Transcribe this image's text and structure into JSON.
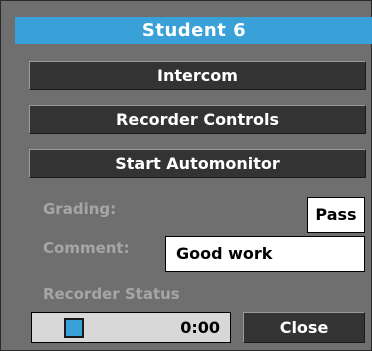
{
  "window": {
    "title": "Student 6"
  },
  "buttons": {
    "intercom": "Intercom",
    "recorder_controls": "Recorder Controls",
    "start_automonitor": "Start Automonitor",
    "close": "Close"
  },
  "grading": {
    "label": "Grading:",
    "value": "Pass"
  },
  "comment": {
    "label": "Comment:",
    "value": "Good work"
  },
  "recorder_status": {
    "label": "Recorder Status",
    "time": "0:00"
  },
  "colors": {
    "panel_background": "#6f6f6f",
    "title_bar": "#3aa1d8",
    "button_background": "#333333",
    "muted_label": "#a6a6a6",
    "status_indicator": "#3aa1d8"
  },
  "icons": {
    "status_indicator": "square-indicator-icon"
  }
}
